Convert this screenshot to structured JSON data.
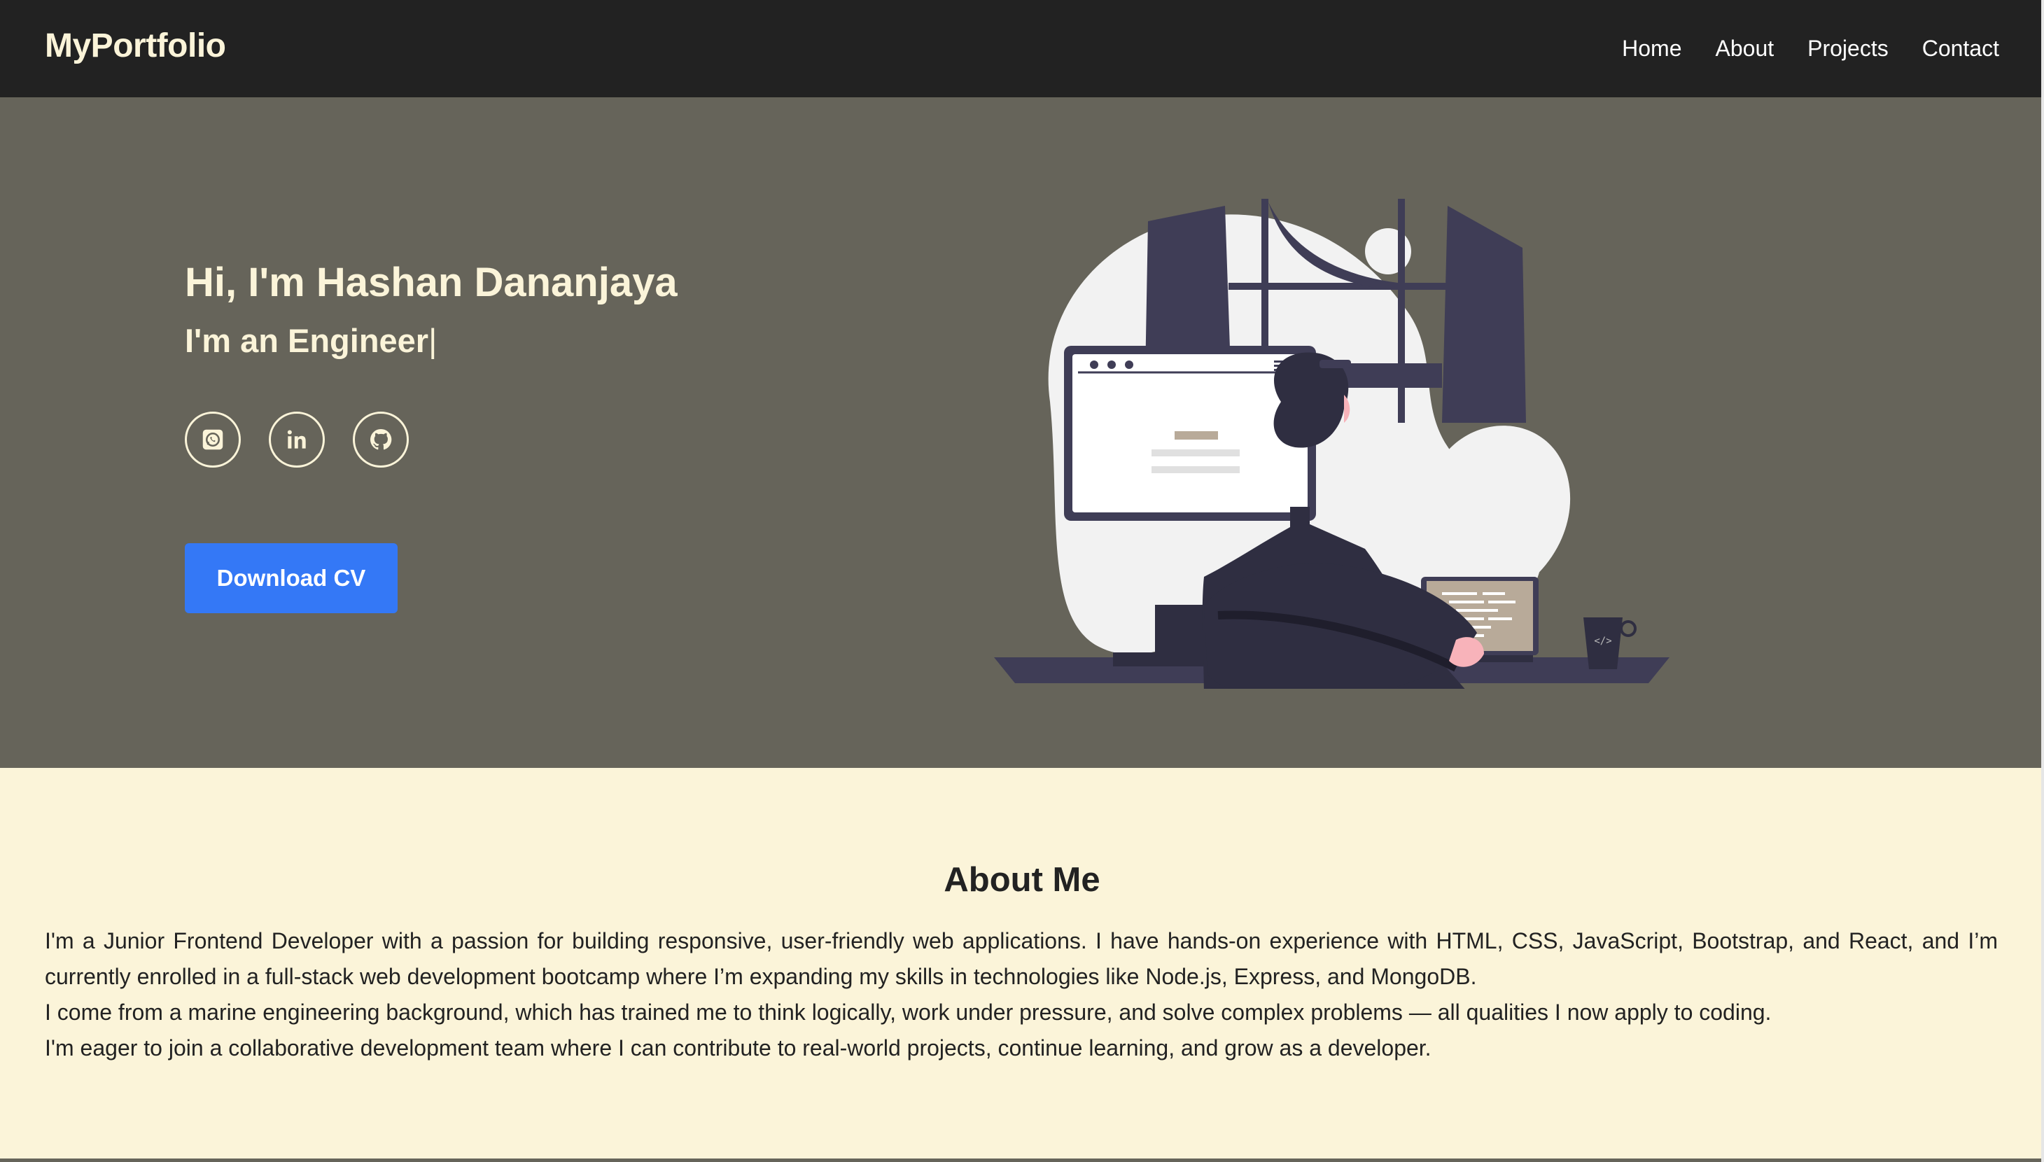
{
  "navbar": {
    "brand": "MyPortfolio",
    "links": [
      "Home",
      "About",
      "Projects",
      "Contact"
    ]
  },
  "hero": {
    "greeting": "Hi, I'm Hashan Dananjaya",
    "role": "I'm an Engineer",
    "cursor": "|",
    "socials": [
      {
        "icon": "whatsapp-icon"
      },
      {
        "icon": "linkedin-icon"
      },
      {
        "icon": "github-icon"
      }
    ],
    "download_label": "Download CV",
    "illustration_icon": "developer-at-desk-illustration"
  },
  "about": {
    "title": "About Me",
    "paragraphs": [
      "I'm a Junior Frontend Developer with a passion for building responsive, user-friendly web applications. I have hands-on experience with HTML, CSS, JavaScript, Bootstrap, and React, and I’m currently enrolled in a full-stack web development bootcamp where I’m expanding my skills in technologies like Node.js, Express, and MongoDB.",
      "I come from a marine engineering background, which has trained me to think logically, work under pressure, and solve complex problems — all qualities I now apply to coding.",
      "I'm eager to join a collaborative development team where I can contribute to real-world projects, continue learning, and grow as a developer."
    ]
  },
  "colors": {
    "navbar_bg": "#222222",
    "hero_bg": "#66645a",
    "accent_text": "#fbf4d9",
    "button_bg": "#3478f6",
    "about_bg": "#fbf4d9"
  }
}
